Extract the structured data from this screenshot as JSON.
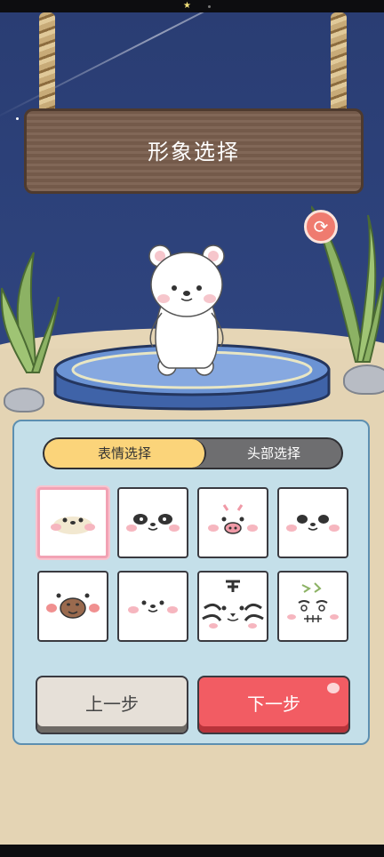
{
  "sign": {
    "title": "形象选择"
  },
  "tabs": [
    {
      "label": "表情选择",
      "active": true
    },
    {
      "label": "头部选择",
      "active": false
    }
  ],
  "faces": [
    {
      "name": "seal-beige",
      "selected": true
    },
    {
      "name": "panda",
      "selected": false
    },
    {
      "name": "pig",
      "selected": false
    },
    {
      "name": "panda-small",
      "selected": false
    },
    {
      "name": "capybara",
      "selected": false
    },
    {
      "name": "seal-white",
      "selected": false
    },
    {
      "name": "tiger",
      "selected": false
    },
    {
      "name": "zombie",
      "selected": false
    }
  ],
  "buttons": {
    "prev_label": "上一步",
    "next_label": "下一步"
  },
  "icons": {
    "refresh": "refresh-icon"
  },
  "colors": {
    "tab_active": "#fbd47a",
    "next_button": "#f25c63",
    "selected_border": "#f2a2b4"
  }
}
